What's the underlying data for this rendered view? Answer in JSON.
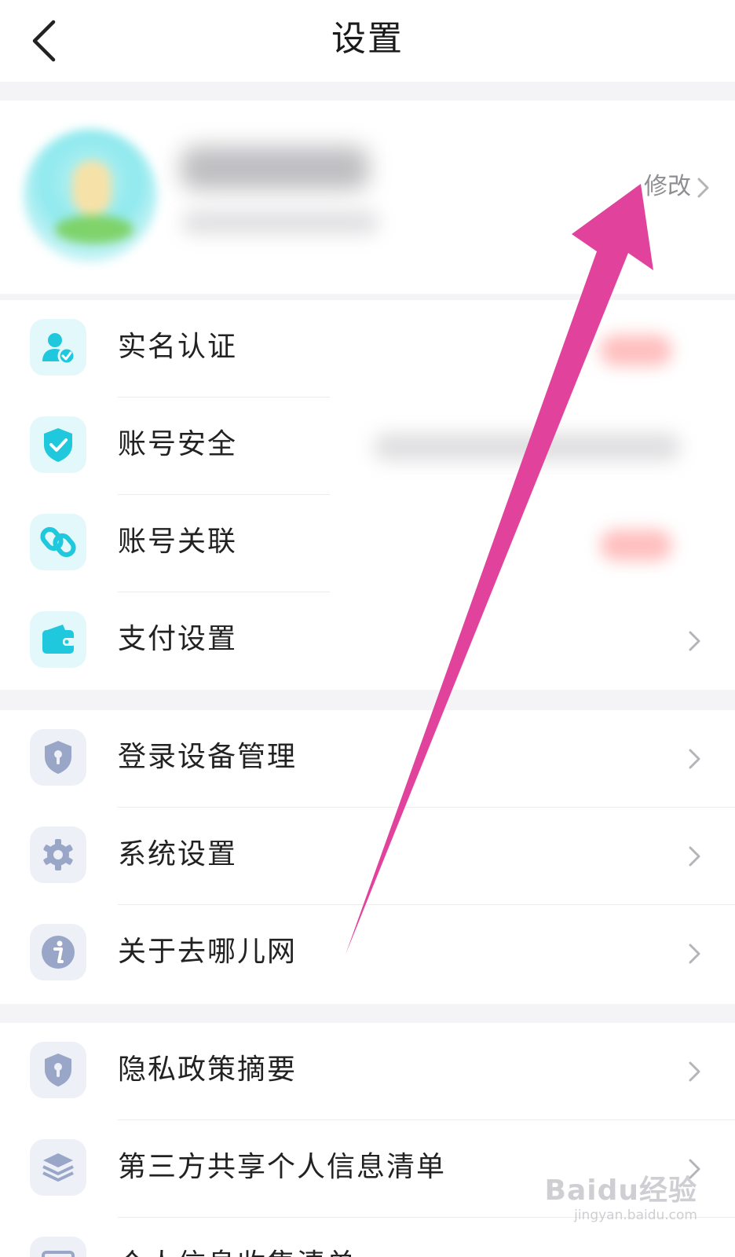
{
  "header": {
    "title": "设置"
  },
  "profile": {
    "edit_label": "修改"
  },
  "groups": [
    {
      "items": [
        {
          "label": "实名认证",
          "icon": "user-verified-icon"
        },
        {
          "label": "账号安全",
          "icon": "shield-check-icon"
        },
        {
          "label": "账号关联",
          "icon": "link-icon"
        },
        {
          "label": "支付设置",
          "icon": "wallet-icon"
        }
      ]
    },
    {
      "items": [
        {
          "label": "登录设备管理",
          "icon": "lock-shield-icon"
        },
        {
          "label": "系统设置",
          "icon": "gear-icon"
        },
        {
          "label": "关于去哪儿网",
          "icon": "info-icon"
        }
      ]
    },
    {
      "items": [
        {
          "label": "隐私政策摘要",
          "icon": "lock-shield-icon"
        },
        {
          "label": "第三方共享个人信息清单",
          "icon": "layers-icon"
        },
        {
          "label": "个人信息收集清单",
          "icon": "document-icon"
        }
      ]
    }
  ],
  "watermark": {
    "logo": "Baidu经验",
    "url": "jingyan.baidu.com"
  },
  "colors": {
    "accent": "#1fc8dc",
    "icon_gray": "#9aa6c8",
    "arrow": "#e0429c"
  }
}
